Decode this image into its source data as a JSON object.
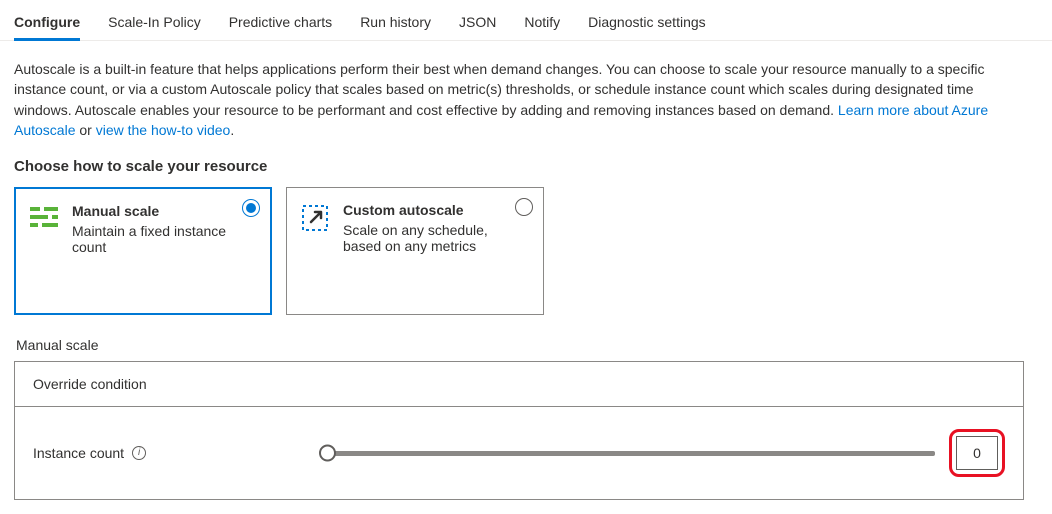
{
  "tabs": {
    "configure": "Configure",
    "scalein": "Scale-In Policy",
    "predictive": "Predictive charts",
    "runhistory": "Run history",
    "json": "JSON",
    "notify": "Notify",
    "diagnostic": "Diagnostic settings"
  },
  "desc": {
    "text_1": "Autoscale is a built-in feature that helps applications perform their best when demand changes. You can choose to scale your resource manually to a specific instance count, or via a custom Autoscale policy that scales based on metric(s) thresholds, or schedule instance count which scales during designated time windows. Autoscale enables your resource to be performant and cost effective by adding and removing instances based on demand. ",
    "link_1": "Learn more about Azure Autoscale",
    "sep": " or ",
    "link_2": "view the how-to video",
    "tail": "."
  },
  "choose_title": "Choose how to scale your resource",
  "cards": {
    "manual": {
      "title": "Manual scale",
      "sub": "Maintain a fixed instance count"
    },
    "custom": {
      "title": "Custom autoscale",
      "sub": "Scale on any schedule, based on any metrics"
    }
  },
  "subhead": "Manual scale",
  "panel": {
    "header": "Override condition",
    "row_label": "Instance count",
    "value": "0"
  }
}
